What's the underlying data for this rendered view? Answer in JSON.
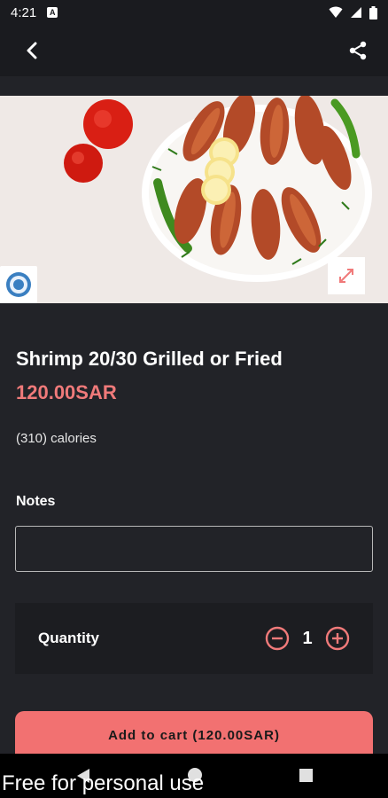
{
  "status_bar": {
    "time": "4:21",
    "notification_letter": "A",
    "icons": [
      "wifi-icon",
      "signal-icon",
      "battery-icon"
    ]
  },
  "app_bar": {
    "back_icon": "chevron-left-icon",
    "share_icon": "share-icon"
  },
  "product": {
    "name": "Shrimp 20/30 Grilled or Fried",
    "price": "120.00SAR",
    "calories": "(310) calories",
    "price_color": "#f07a7a"
  },
  "notes": {
    "label": "Notes",
    "value": "",
    "placeholder": ""
  },
  "quantity": {
    "label": "Quantity",
    "value": "1",
    "accent_color": "#f07a7a"
  },
  "cart_button": {
    "label": "Add to cart (120.00SAR)",
    "color": "#f27171"
  },
  "watermark": "Free for personal use"
}
